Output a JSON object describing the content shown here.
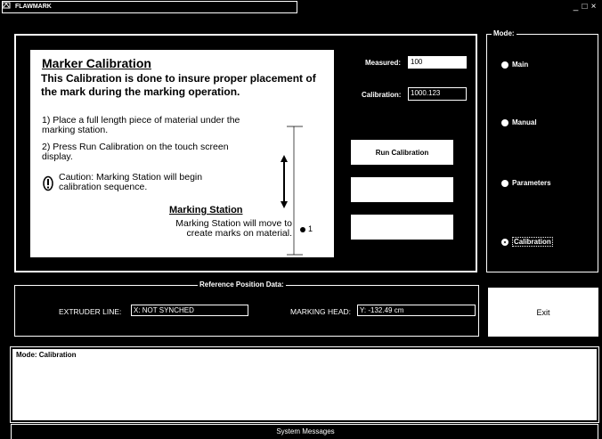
{
  "window": {
    "title": "FLAWMARK",
    "minimize": "_",
    "maximize": "□",
    "close": "×"
  },
  "instructions": {
    "title": "Marker Calibration",
    "intro": "This Calibration is done to insure proper placement of the mark during the marking operation.",
    "step1": "1) Place a full length piece of material under the marking station.",
    "step2": "2) Press Run Calibration on the touch screen display.",
    "caution": "Caution: Marking Station will begin calibration sequence.",
    "station_title": "Marking Station",
    "station_text": "Marking Station will move to create marks on material.",
    "marker_label": "1"
  },
  "fields": {
    "measured_label": "Measured:",
    "measured_value": "100",
    "calibration_label": "Calibration:",
    "calibration_value": "1000.123"
  },
  "buttons": {
    "run_calibration": "Run Calibration",
    "blank1": "",
    "blank2": "",
    "exit": "Exit"
  },
  "mode": {
    "legend": "Mode:",
    "options": [
      "Main",
      "Manual",
      "Parameters",
      "Calibration"
    ],
    "selected": "Calibration"
  },
  "reference": {
    "legend": "Reference Position Data:",
    "extruder_label": "EXTRUDER LINE:",
    "extruder_value": "X: NOT SYNCHED",
    "marking_head_label": "MARKING HEAD:",
    "marking_head_value": "Y: -132.49 cm"
  },
  "messages": {
    "text": "Mode: Calibration",
    "footer": "System Messages"
  }
}
